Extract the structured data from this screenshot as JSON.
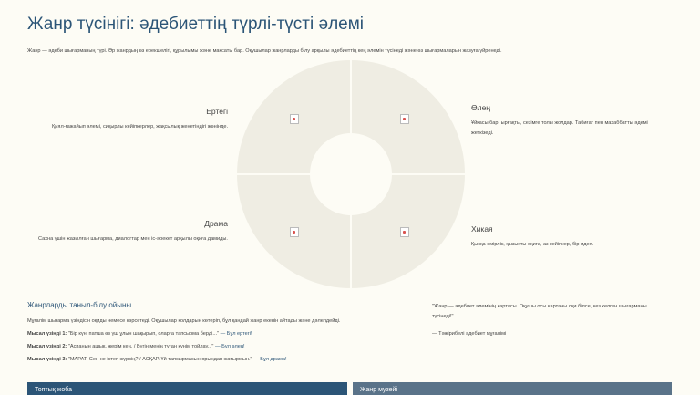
{
  "page": {
    "title": "Жанр түсінігі: әдебиеттің түрлі-түсті әлемі",
    "intro": "Жанр — әдеби шығарманың түрі. Әр жанрдың өз ерекшелігі, құрылымы және мақсаты бар. Оқушылар жанрларды білу арқылы әдебиеттің кең әлемін түсінеді және өз шығармаларын жазуға үйренеді."
  },
  "genres": [
    {
      "name": "Ертегі",
      "desc": "Қиял-ғажайып әлемі, сиқырлы кейіпкерлер, жақсылық жеңетіндігі жөнінде."
    },
    {
      "name": "Өлең",
      "desc": "Ұйқасы бар, ырғақты, сезімге толы жолдар. Табиғат пен махаббатты әдемі жеткізеді."
    },
    {
      "name": "Драма",
      "desc": "Сахна үшін жазылған шығарма, диалогтар мен іс-әрекет арқылы оқиға дамиды."
    },
    {
      "name": "Хикая",
      "desc": "Қысқа өмірлік, қызықты оқиға, аз кейіпкер, бір идея."
    }
  ],
  "game": {
    "heading": "Жанрларды таныл-білу ойыны",
    "instruction": "Мұғалім шығарма үзіндісін оқиды немесе көрсетеді. Оқушылар қолдарын көтеріп, бұл қандай жанр екенін айтады және дәлелдейді.",
    "examples": [
      {
        "label": "Мысал үзінді 1:",
        "text": "\"Бір күні патша өз үш ұлын шақырып, оларға тапсырма берді...\"",
        "answer": "— Бұл ертегі!"
      },
      {
        "label": "Мысал үзінді 2:",
        "text": "\"Аспанын ашық, жерім кең, / Бүгін менің туған күнім тойлау...\"",
        "answer": "— Бұл өлең!"
      },
      {
        "label": "Мысал үзінді 3:",
        "text": "\"МАРАТ. Сен не істеп жүрсің? / АСҚАР. Үй тапсырмасын орындап жатырмын.\"",
        "answer": "— Бұл драма!"
      }
    ]
  },
  "quote": {
    "text": "\"Жанр — әдебиет әлемінің картасы. Оқушы осы картаны оқи білсе, кез келген шығарманы түсінеді!\"",
    "author": "— Тәжірибелі әдебиет мұғалімі"
  },
  "panels": [
    {
      "label": "Топтық жоба"
    },
    {
      "label": "Жанр музейі"
    }
  ]
}
